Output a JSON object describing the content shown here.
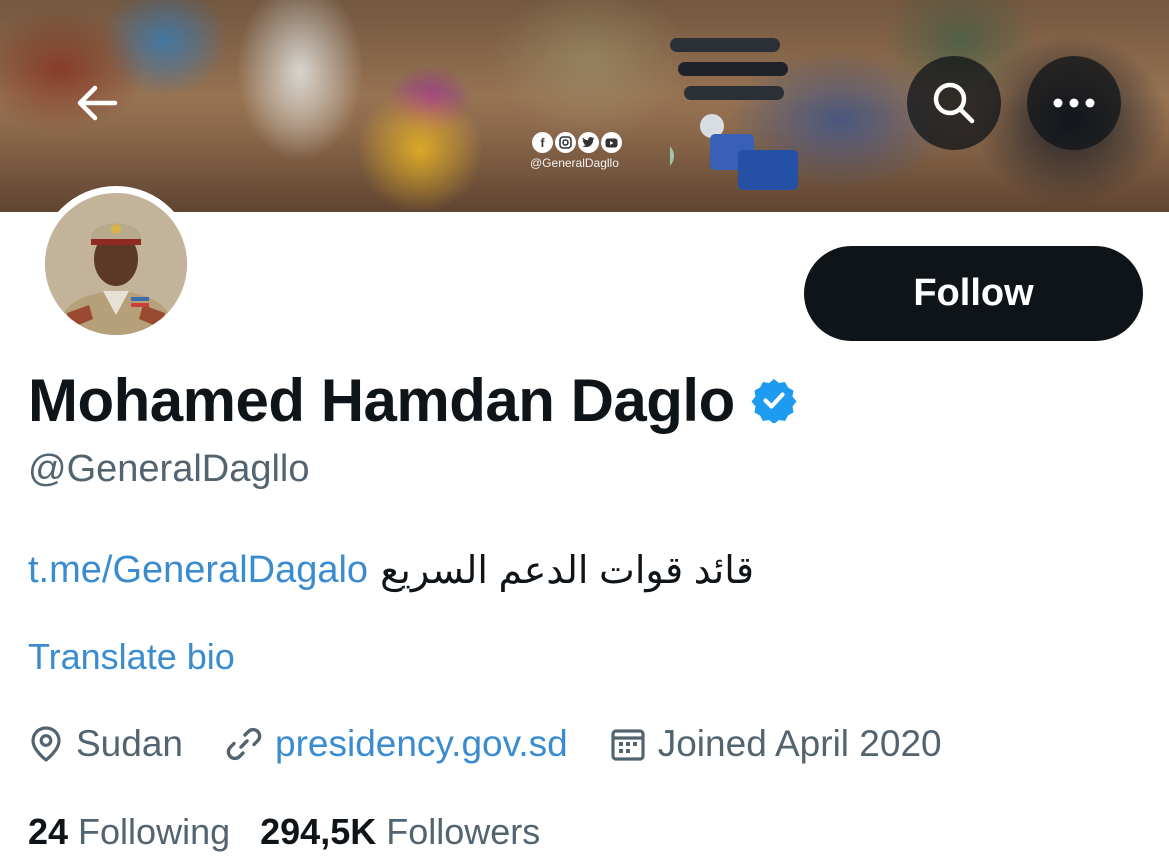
{
  "profile": {
    "display_name": "Mohamed Hamdan Daglo",
    "handle": "@GeneralDagllo",
    "verified": true,
    "bio_link": "t.me/GeneralDagalo",
    "bio_text": "قائد قوات الدعم السريع",
    "translate_label": "Translate bio",
    "location": "Sudan",
    "website": "presidency.gov.sd",
    "joined": "Joined April 2020",
    "following_count": "24",
    "following_label": "Following",
    "followers_count": "294,5K",
    "followers_label": "Followers"
  },
  "banner": {
    "watermark_handle": "@GeneralDagllo",
    "social_icons": [
      "facebook-icon",
      "instagram-icon",
      "twitter-icon",
      "youtube-icon"
    ]
  },
  "header": {
    "back_icon": "arrow-left-icon",
    "search_icon": "search-icon",
    "more_icon": "more-horizontal-icon"
  },
  "actions": {
    "follow_label": "Follow"
  },
  "colors": {
    "text_primary": "#0f1419",
    "text_secondary": "#536471",
    "link": "#3b8ccf",
    "verified_badge": "#1d9bf0",
    "follow_button_bg": "#0f1419"
  }
}
